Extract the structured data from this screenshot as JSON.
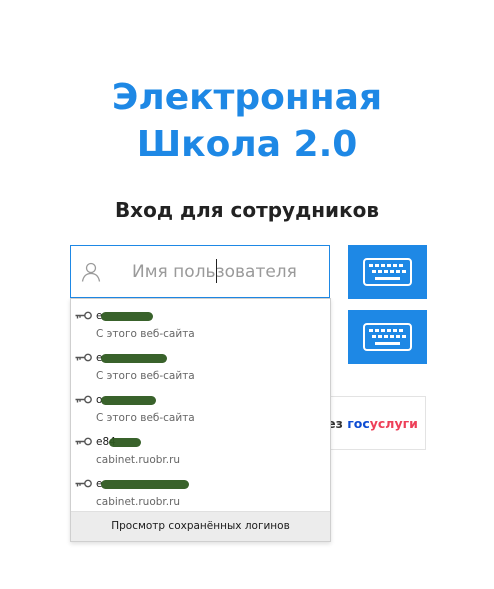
{
  "header": {
    "title_line1": "Электронная",
    "title_line2": "Школа 2.0",
    "subtitle": "Вход для сотрудников"
  },
  "login_form": {
    "username_placeholder": "Имя пользователя",
    "username_value": "",
    "gosuslugi_prefix": "ез",
    "gosuslugi_gos": "гос",
    "gosuslugi_uslugi": "услуги"
  },
  "autocomplete": {
    "suggestions": [
      {
        "login": "e",
        "source": "С этого веб-сайта"
      },
      {
        "login": "e",
        "source": "С этого веб-сайта"
      },
      {
        "login": "o",
        "source": "С этого веб-сайта"
      },
      {
        "login": "e84",
        "source": "cabinet.ruobr.ru"
      },
      {
        "login": "e",
        "source": "cabinet.ruobr.ru"
      }
    ],
    "footer_label": "Просмотр сохранённых логинов"
  },
  "colors": {
    "accent": "#1e88e5",
    "gosuslugi_blue": "#0d4cd3",
    "gosuslugi_red": "#ee3f58"
  },
  "icons": {
    "user": "user-icon",
    "keyboard": "keyboard-icon",
    "key": "key-icon"
  }
}
